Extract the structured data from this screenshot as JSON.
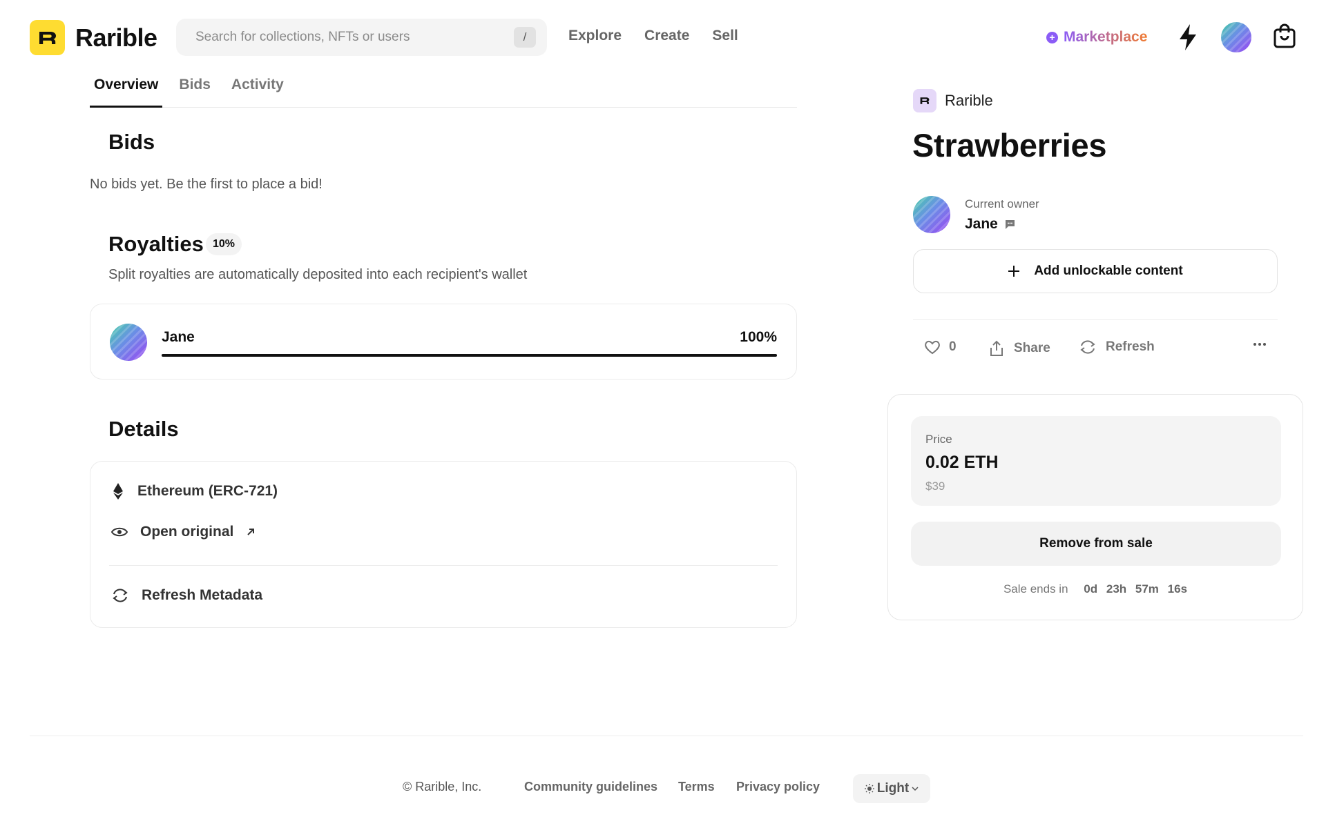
{
  "header": {
    "logo_text": "Rarible",
    "search_placeholder": "Search for collections, NFTs or users",
    "search_shortcut": "/",
    "nav": [
      "Explore",
      "Create",
      "Sell"
    ],
    "marketplace_label": "Marketplace"
  },
  "tabs": [
    "Overview",
    "Bids",
    "Activity"
  ],
  "bids": {
    "title": "Bids",
    "empty_text": "No bids yet. Be the first to place a bid!"
  },
  "royalties": {
    "title": "Royalties",
    "badge": "10%",
    "description": "Split royalties are automatically deposited into each recipient's wallet",
    "recipient_name": "Jane",
    "recipient_percent": "100%",
    "recipient_share": 1.0
  },
  "details": {
    "title": "Details",
    "blockchain": "Ethereum (ERC-721)",
    "open_original": "Open original",
    "refresh_metadata": "Refresh Metadata"
  },
  "item": {
    "collection_name": "Rarible",
    "title": "Strawberries",
    "owner_label": "Current owner",
    "owner_name": "Jane",
    "unlockable_label": "Add unlockable content",
    "likes": "0",
    "share_label": "Share",
    "refresh_label": "Refresh"
  },
  "sale": {
    "price_label": "Price",
    "price": "0.02 ETH",
    "price_usd": "$39",
    "remove_label": "Remove from sale",
    "ends_label": "Sale ends in",
    "days": "0d",
    "hours": "23h",
    "minutes": "57m",
    "seconds": "16s"
  },
  "footer": {
    "copyright": "© Rarible, Inc.",
    "community": "Community guidelines",
    "terms": "Terms",
    "privacy": "Privacy policy",
    "theme": "Light"
  },
  "colors": {
    "logo_yellow": "#fedc31",
    "marketplace_purple": "#8b5cf6",
    "marketplace_orange": "#f07a2f"
  }
}
